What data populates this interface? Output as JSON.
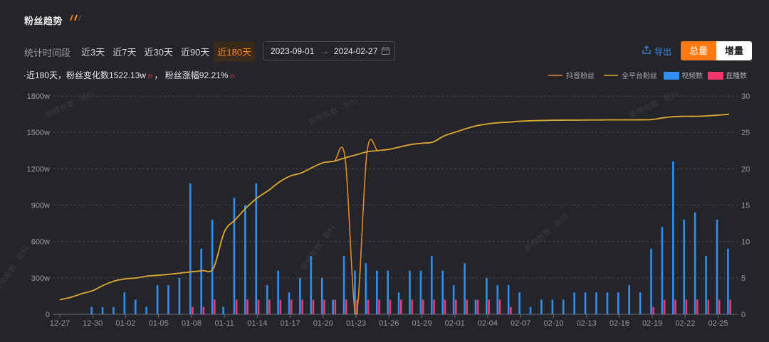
{
  "header": {
    "title": "粉丝趋势"
  },
  "filters": {
    "period_label": "统计时间段",
    "tabs": [
      {
        "label": "近3天",
        "active": false
      },
      {
        "label": "近7天",
        "active": false
      },
      {
        "label": "近30天",
        "active": false
      },
      {
        "label": "近90天",
        "active": false
      },
      {
        "label": "近180天",
        "active": true
      }
    ],
    "date_start": "2023-09-01",
    "date_arrow": "→",
    "date_end": "2024-02-27"
  },
  "actions": {
    "export_label": "导出",
    "mode_total": "总量",
    "mode_increment": "增量",
    "mode_selected": "总量"
  },
  "summary": {
    "prefix": "·近180天，粉丝变化数",
    "change_value": "1522.13w",
    "separator": "，",
    "growth_label": "粉丝涨幅",
    "growth_value": "92.21%"
  },
  "watermark": "新榜有数 · 新抖",
  "colors": {
    "douyin": "#e3882a",
    "all_platform": "#d9a632",
    "video": "#2e8ff0",
    "live": "#f0386a",
    "accent": "#ff7a10"
  },
  "chart_data": {
    "type": "bar+line",
    "legend": [
      "抖音粉丝",
      "全平台粉丝",
      "视频数",
      "直播数"
    ],
    "legend_position": "top-right",
    "grid": true,
    "x_labels": [
      "12-27",
      "12-30",
      "01-02",
      "01-05",
      "01-08",
      "01-11",
      "01-14",
      "01-17",
      "01-20",
      "01-23",
      "01-26",
      "01-29",
      "02-01",
      "02-04",
      "02-07",
      "02-10",
      "02-13",
      "02-16",
      "02-19",
      "02-22",
      "02-25"
    ],
    "dates": [
      "12-27",
      "12-28",
      "12-29",
      "12-30",
      "12-31",
      "01-01",
      "01-02",
      "01-03",
      "01-04",
      "01-05",
      "01-06",
      "01-07",
      "01-08",
      "01-09",
      "01-10",
      "01-11",
      "01-12",
      "01-13",
      "01-14",
      "01-15",
      "01-16",
      "01-17",
      "01-18",
      "01-19",
      "01-20",
      "01-21",
      "01-22",
      "01-23",
      "01-24",
      "01-25",
      "01-26",
      "01-27",
      "01-28",
      "01-29",
      "01-30",
      "01-31",
      "02-01",
      "02-02",
      "02-03",
      "02-04",
      "02-05",
      "02-06",
      "02-07",
      "02-08",
      "02-09",
      "02-10",
      "02-11",
      "02-12",
      "02-13",
      "02-14",
      "02-15",
      "02-16",
      "02-17",
      "02-18",
      "02-19",
      "02-20",
      "02-21",
      "02-22",
      "02-23",
      "02-24",
      "02-25",
      "02-26"
    ],
    "y_left": {
      "ticks": [
        "0",
        "300w",
        "600w",
        "900w",
        "1200w",
        "1500w",
        "1800w"
      ],
      "min": 0,
      "max": 1800
    },
    "y_right": {
      "ticks": [
        "0",
        "5",
        "10",
        "15",
        "20",
        "25",
        "30"
      ],
      "min": 0,
      "max": 30
    },
    "series": [
      {
        "name": "抖音粉丝",
        "type": "line",
        "axis": "left",
        "values": [
          120,
          140,
          170,
          195,
          240,
          275,
          292,
          300,
          315,
          322,
          330,
          340,
          350,
          360,
          380,
          680,
          780,
          880,
          960,
          1020,
          1090,
          1140,
          1165,
          1210,
          1250,
          1262,
          1290,
          0,
          1340,
          1350,
          1360,
          1380,
          1400,
          1410,
          1420,
          1470,
          1500,
          1530,
          1555,
          1570,
          1580,
          1585,
          1592,
          1596,
          1598,
          1600,
          1601,
          1601,
          1602,
          1602,
          1603,
          1603,
          1603,
          1604,
          1606,
          1620,
          1630,
          1632,
          1632,
          1636,
          1642,
          1650
        ]
      },
      {
        "name": "全平台粉丝",
        "type": "line",
        "axis": "left",
        "values": [
          120,
          140,
          170,
          195,
          240,
          275,
          292,
          300,
          315,
          322,
          330,
          340,
          350,
          360,
          380,
          680,
          780,
          880,
          960,
          1020,
          1090,
          1140,
          1165,
          1210,
          1250,
          1262,
          1290,
          1315,
          1340,
          1350,
          1360,
          1380,
          1400,
          1410,
          1420,
          1470,
          1500,
          1530,
          1555,
          1570,
          1580,
          1585,
          1592,
          1596,
          1598,
          1600,
          1601,
          1601,
          1602,
          1602,
          1603,
          1603,
          1603,
          1604,
          1606,
          1620,
          1630,
          1632,
          1632,
          1636,
          1642,
          1650
        ]
      },
      {
        "name": "视频数",
        "type": "bar",
        "axis": "right",
        "values": [
          0,
          0,
          0,
          1,
          1,
          1,
          3,
          2,
          1,
          4,
          4,
          5,
          18,
          9,
          13,
          1,
          16,
          15,
          18,
          4,
          6,
          3,
          5,
          8,
          5,
          2,
          8,
          6,
          7,
          6,
          6,
          3,
          6,
          6,
          8,
          6,
          4,
          7,
          2,
          5,
          4,
          4,
          3,
          1,
          2,
          2,
          2,
          3,
          3,
          3,
          3,
          3,
          4,
          3,
          9,
          12,
          21,
          13,
          14,
          8,
          13,
          9
        ]
      },
      {
        "name": "直播数",
        "type": "bar",
        "axis": "right",
        "values": [
          0,
          0,
          0,
          0,
          0,
          0,
          0,
          0,
          0,
          0,
          0,
          0,
          1,
          1,
          2,
          0,
          2,
          2,
          2,
          2,
          2,
          2,
          2,
          2,
          2,
          2,
          2,
          2,
          2,
          2,
          2,
          2,
          2,
          2,
          2,
          2,
          2,
          2,
          2,
          2,
          2,
          1,
          0,
          0,
          0,
          0,
          0,
          0,
          0,
          0,
          0,
          0,
          0,
          0,
          1,
          2,
          2,
          2,
          2,
          2,
          2,
          2
        ]
      }
    ]
  }
}
